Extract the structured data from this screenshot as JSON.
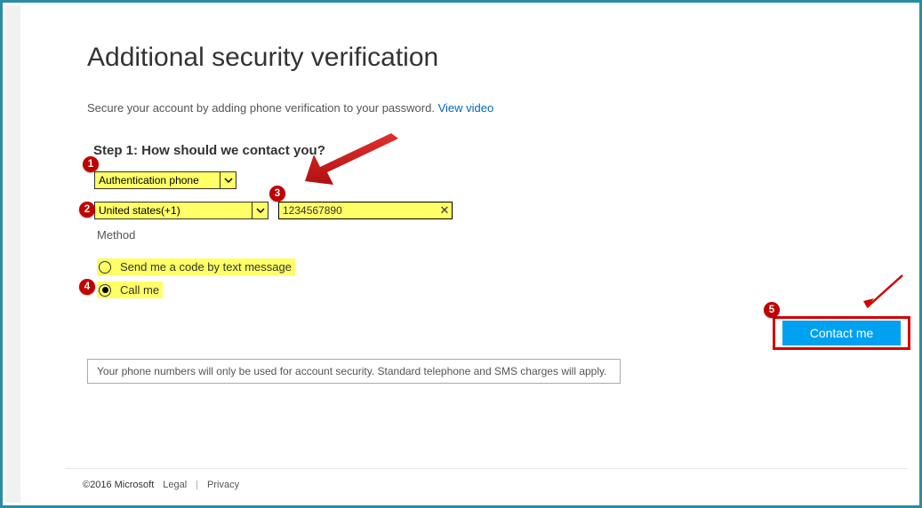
{
  "title": "Additional security verification",
  "subtitle_text": "Secure your account by adding phone verification to your password. ",
  "subtitle_link": "View video",
  "step_heading": "Step 1: How should we contact you?",
  "select_contact": "Authentication phone",
  "select_country": "United states(+1)",
  "phone_value": "1234567890",
  "method_label": "Method",
  "option_text": "Send me a code by text message",
  "option_call": "Call me",
  "contact_button": "Contact me",
  "notice": "Your phone numbers will only be used for account security. Standard telephone and SMS charges will apply.",
  "footer_copyright": "©2016 Microsoft",
  "footer_legal": "Legal",
  "footer_privacy": "Privacy",
  "badges": {
    "b1": "1",
    "b2": "2",
    "b3": "3",
    "b4": "4",
    "b5": "5"
  }
}
